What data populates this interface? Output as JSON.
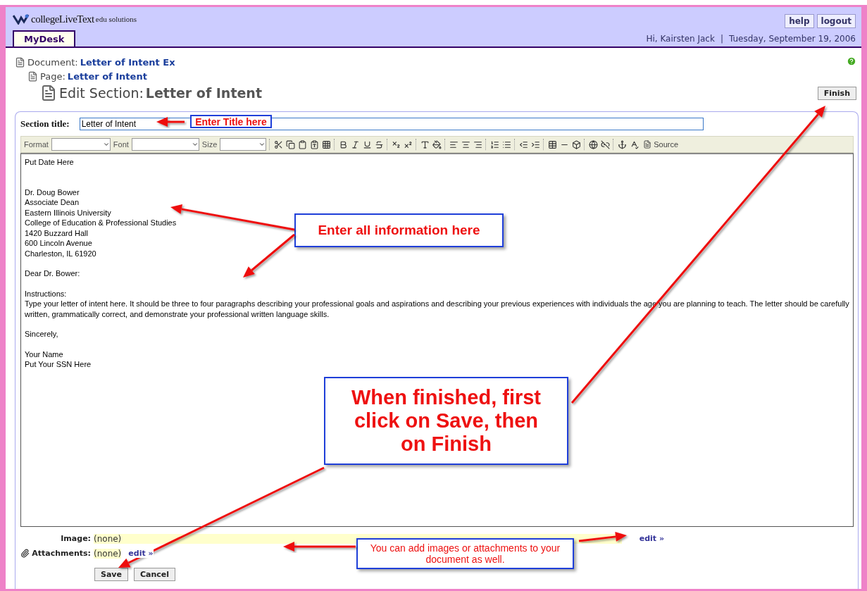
{
  "header": {
    "logo": {
      "brand": "collegeLiveText",
      "suffix": "edu solutions"
    },
    "links": [
      {
        "label": "help"
      },
      {
        "label": "logout"
      }
    ],
    "tabs": [
      {
        "label": "MyDesk",
        "selected": true
      }
    ],
    "greeting": "Hi, Kairsten Jack",
    "separator": "|",
    "date": "Tuesday, September 19, 2006"
  },
  "breadcrumb": [
    {
      "kind": "document",
      "label": "Document:",
      "value": "Letter of Intent Ex"
    },
    {
      "kind": "page",
      "label": "Page:",
      "value": "Letter of Intent"
    },
    {
      "kind": "section",
      "label": "Edit Section:",
      "value": "Letter of Intent"
    }
  ],
  "finish_button": "Finish",
  "section_title": {
    "label": "Section title:",
    "value": "Letter of Intent"
  },
  "toolbar": {
    "dropdowns": [
      {
        "label": "Format"
      },
      {
        "label": "Font"
      },
      {
        "label": "Size"
      }
    ],
    "source_button": "Source"
  },
  "editor_blocks": [
    [
      "Put Date Here"
    ],
    [
      "Dr. Doug Bower",
      "Associate Dean",
      "Eastern Illinois University",
      "College of Education & Professional Studies",
      "1420 Buzzard Hall",
      "600 Lincoln Avenue",
      "Charleston, IL  61920"
    ],
    [
      "Dear Dr. Bower:"
    ],
    [
      "Instructions:",
      "Type your letter of intent here.  It should be three to four paragraphs describing your professional goals and aspirations and describing your previous experiences with individuals the age you are planning to teach.  The letter should be carefully written, grammatically correct, and demonstrate your professional written language skills."
    ],
    [
      "Sincerely,"
    ],
    [
      "Your Name",
      "Put Your SSN Here"
    ]
  ],
  "fields": [
    {
      "kind": "image",
      "label": "Image:",
      "value": "(none)",
      "link": "edit »"
    },
    {
      "kind": "attachment",
      "label": "Attachments:",
      "value": "(none)",
      "link": "edit »"
    }
  ],
  "buttons": [
    "Save",
    "Cancel"
  ],
  "annotations": [
    {
      "kind": "small",
      "text": "Enter Title here"
    },
    {
      "kind": "medium",
      "text": "Enter all information here"
    },
    {
      "kind": "large",
      "text": "When finished, first click on Save, then on Finish"
    },
    {
      "kind": "note",
      "text": "You can add images or attachments to your document as well."
    }
  ]
}
